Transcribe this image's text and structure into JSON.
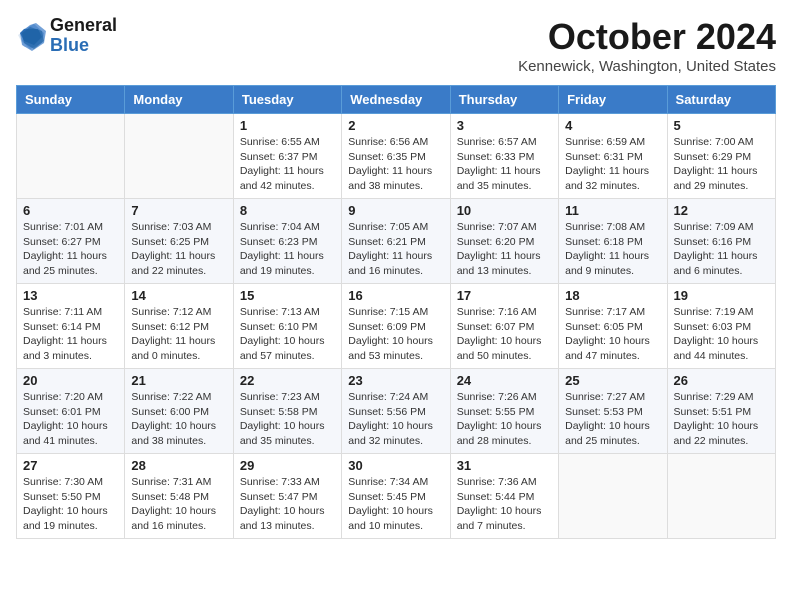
{
  "header": {
    "logo_general": "General",
    "logo_blue": "Blue",
    "month_title": "October 2024",
    "location": "Kennewick, Washington, United States"
  },
  "weekdays": [
    "Sunday",
    "Monday",
    "Tuesday",
    "Wednesday",
    "Thursday",
    "Friday",
    "Saturday"
  ],
  "weeks": [
    [
      {
        "day": "",
        "sunrise": "",
        "sunset": "",
        "daylight": ""
      },
      {
        "day": "",
        "sunrise": "",
        "sunset": "",
        "daylight": ""
      },
      {
        "day": "1",
        "sunrise": "Sunrise: 6:55 AM",
        "sunset": "Sunset: 6:37 PM",
        "daylight": "Daylight: 11 hours and 42 minutes."
      },
      {
        "day": "2",
        "sunrise": "Sunrise: 6:56 AM",
        "sunset": "Sunset: 6:35 PM",
        "daylight": "Daylight: 11 hours and 38 minutes."
      },
      {
        "day": "3",
        "sunrise": "Sunrise: 6:57 AM",
        "sunset": "Sunset: 6:33 PM",
        "daylight": "Daylight: 11 hours and 35 minutes."
      },
      {
        "day": "4",
        "sunrise": "Sunrise: 6:59 AM",
        "sunset": "Sunset: 6:31 PM",
        "daylight": "Daylight: 11 hours and 32 minutes."
      },
      {
        "day": "5",
        "sunrise": "Sunrise: 7:00 AM",
        "sunset": "Sunset: 6:29 PM",
        "daylight": "Daylight: 11 hours and 29 minutes."
      }
    ],
    [
      {
        "day": "6",
        "sunrise": "Sunrise: 7:01 AM",
        "sunset": "Sunset: 6:27 PM",
        "daylight": "Daylight: 11 hours and 25 minutes."
      },
      {
        "day": "7",
        "sunrise": "Sunrise: 7:03 AM",
        "sunset": "Sunset: 6:25 PM",
        "daylight": "Daylight: 11 hours and 22 minutes."
      },
      {
        "day": "8",
        "sunrise": "Sunrise: 7:04 AM",
        "sunset": "Sunset: 6:23 PM",
        "daylight": "Daylight: 11 hours and 19 minutes."
      },
      {
        "day": "9",
        "sunrise": "Sunrise: 7:05 AM",
        "sunset": "Sunset: 6:21 PM",
        "daylight": "Daylight: 11 hours and 16 minutes."
      },
      {
        "day": "10",
        "sunrise": "Sunrise: 7:07 AM",
        "sunset": "Sunset: 6:20 PM",
        "daylight": "Daylight: 11 hours and 13 minutes."
      },
      {
        "day": "11",
        "sunrise": "Sunrise: 7:08 AM",
        "sunset": "Sunset: 6:18 PM",
        "daylight": "Daylight: 11 hours and 9 minutes."
      },
      {
        "day": "12",
        "sunrise": "Sunrise: 7:09 AM",
        "sunset": "Sunset: 6:16 PM",
        "daylight": "Daylight: 11 hours and 6 minutes."
      }
    ],
    [
      {
        "day": "13",
        "sunrise": "Sunrise: 7:11 AM",
        "sunset": "Sunset: 6:14 PM",
        "daylight": "Daylight: 11 hours and 3 minutes."
      },
      {
        "day": "14",
        "sunrise": "Sunrise: 7:12 AM",
        "sunset": "Sunset: 6:12 PM",
        "daylight": "Daylight: 11 hours and 0 minutes."
      },
      {
        "day": "15",
        "sunrise": "Sunrise: 7:13 AM",
        "sunset": "Sunset: 6:10 PM",
        "daylight": "Daylight: 10 hours and 57 minutes."
      },
      {
        "day": "16",
        "sunrise": "Sunrise: 7:15 AM",
        "sunset": "Sunset: 6:09 PM",
        "daylight": "Daylight: 10 hours and 53 minutes."
      },
      {
        "day": "17",
        "sunrise": "Sunrise: 7:16 AM",
        "sunset": "Sunset: 6:07 PM",
        "daylight": "Daylight: 10 hours and 50 minutes."
      },
      {
        "day": "18",
        "sunrise": "Sunrise: 7:17 AM",
        "sunset": "Sunset: 6:05 PM",
        "daylight": "Daylight: 10 hours and 47 minutes."
      },
      {
        "day": "19",
        "sunrise": "Sunrise: 7:19 AM",
        "sunset": "Sunset: 6:03 PM",
        "daylight": "Daylight: 10 hours and 44 minutes."
      }
    ],
    [
      {
        "day": "20",
        "sunrise": "Sunrise: 7:20 AM",
        "sunset": "Sunset: 6:01 PM",
        "daylight": "Daylight: 10 hours and 41 minutes."
      },
      {
        "day": "21",
        "sunrise": "Sunrise: 7:22 AM",
        "sunset": "Sunset: 6:00 PM",
        "daylight": "Daylight: 10 hours and 38 minutes."
      },
      {
        "day": "22",
        "sunrise": "Sunrise: 7:23 AM",
        "sunset": "Sunset: 5:58 PM",
        "daylight": "Daylight: 10 hours and 35 minutes."
      },
      {
        "day": "23",
        "sunrise": "Sunrise: 7:24 AM",
        "sunset": "Sunset: 5:56 PM",
        "daylight": "Daylight: 10 hours and 32 minutes."
      },
      {
        "day": "24",
        "sunrise": "Sunrise: 7:26 AM",
        "sunset": "Sunset: 5:55 PM",
        "daylight": "Daylight: 10 hours and 28 minutes."
      },
      {
        "day": "25",
        "sunrise": "Sunrise: 7:27 AM",
        "sunset": "Sunset: 5:53 PM",
        "daylight": "Daylight: 10 hours and 25 minutes."
      },
      {
        "day": "26",
        "sunrise": "Sunrise: 7:29 AM",
        "sunset": "Sunset: 5:51 PM",
        "daylight": "Daylight: 10 hours and 22 minutes."
      }
    ],
    [
      {
        "day": "27",
        "sunrise": "Sunrise: 7:30 AM",
        "sunset": "Sunset: 5:50 PM",
        "daylight": "Daylight: 10 hours and 19 minutes."
      },
      {
        "day": "28",
        "sunrise": "Sunrise: 7:31 AM",
        "sunset": "Sunset: 5:48 PM",
        "daylight": "Daylight: 10 hours and 16 minutes."
      },
      {
        "day": "29",
        "sunrise": "Sunrise: 7:33 AM",
        "sunset": "Sunset: 5:47 PM",
        "daylight": "Daylight: 10 hours and 13 minutes."
      },
      {
        "day": "30",
        "sunrise": "Sunrise: 7:34 AM",
        "sunset": "Sunset: 5:45 PM",
        "daylight": "Daylight: 10 hours and 10 minutes."
      },
      {
        "day": "31",
        "sunrise": "Sunrise: 7:36 AM",
        "sunset": "Sunset: 5:44 PM",
        "daylight": "Daylight: 10 hours and 7 minutes."
      },
      {
        "day": "",
        "sunrise": "",
        "sunset": "",
        "daylight": ""
      },
      {
        "day": "",
        "sunrise": "",
        "sunset": "",
        "daylight": ""
      }
    ]
  ]
}
